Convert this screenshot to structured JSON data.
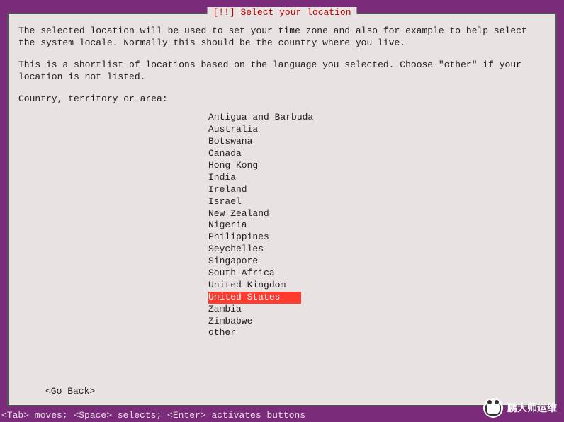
{
  "dialog": {
    "title": "[!!] Select your location",
    "paragraph1": "The selected location will be used to set your time zone and also for example to help select the system locale. Normally this should be the country where you live.",
    "paragraph2": "This is a shortlist of locations based on the language you selected. Choose \"other\" if your location is not listed.",
    "prompt": "Country, territory or area:",
    "go_back": "<Go Back>"
  },
  "countries": [
    "Antigua and Barbuda",
    "Australia",
    "Botswana",
    "Canada",
    "Hong Kong",
    "India",
    "Ireland",
    "Israel",
    "New Zealand",
    "Nigeria",
    "Philippines",
    "Seychelles",
    "Singapore",
    "South Africa",
    "United Kingdom",
    "United States",
    "Zambia",
    "Zimbabwe",
    "other"
  ],
  "selected_index": 15,
  "footer_hint": "<Tab> moves; <Space> selects; <Enter> activates buttons",
  "watermark": "鹏大师运维"
}
